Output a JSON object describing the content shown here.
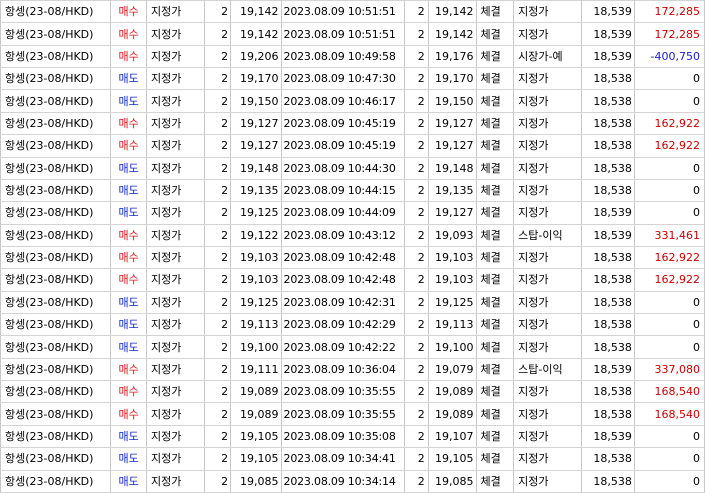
{
  "colors": {
    "buy": "#e0141e",
    "sell": "#1428d2",
    "profit_positive": "#cc0000",
    "profit_negative": "#1a1ad6",
    "profit_zero": "#000000"
  },
  "rows": [
    {
      "product": "항셍(23-08/HKD)",
      "side": "매수",
      "side_type": "buy",
      "order_type": "지정가",
      "qty": "2",
      "order_price": "19,142",
      "datetime": "2023.08.09 10:51:51",
      "fill_qty": "2",
      "fill_price": "19,142",
      "status": "체결",
      "fill_type": "지정가",
      "cur_price": "18,539",
      "profit": "172,285",
      "profit_sign": "pos"
    },
    {
      "product": "항셍(23-08/HKD)",
      "side": "매수",
      "side_type": "buy",
      "order_type": "지정가",
      "qty": "2",
      "order_price": "19,142",
      "datetime": "2023.08.09 10:51:51",
      "fill_qty": "2",
      "fill_price": "19,142",
      "status": "체결",
      "fill_type": "지정가",
      "cur_price": "18,539",
      "profit": "172,285",
      "profit_sign": "pos"
    },
    {
      "product": "항셍(23-08/HKD)",
      "side": "매수",
      "side_type": "buy",
      "order_type": "지정가",
      "qty": "2",
      "order_price": "19,206",
      "datetime": "2023.08.09 10:49:58",
      "fill_qty": "2",
      "fill_price": "19,176",
      "status": "체결",
      "fill_type": "시장가-예",
      "cur_price": "18,539",
      "profit": "-400,750",
      "profit_sign": "neg"
    },
    {
      "product": "항셍(23-08/HKD)",
      "side": "매도",
      "side_type": "sell",
      "order_type": "지정가",
      "qty": "2",
      "order_price": "19,170",
      "datetime": "2023.08.09 10:47:30",
      "fill_qty": "2",
      "fill_price": "19,170",
      "status": "체결",
      "fill_type": "지정가",
      "cur_price": "18,538",
      "profit": "0",
      "profit_sign": "zero"
    },
    {
      "product": "항셍(23-08/HKD)",
      "side": "매도",
      "side_type": "sell",
      "order_type": "지정가",
      "qty": "2",
      "order_price": "19,150",
      "datetime": "2023.08.09 10:46:17",
      "fill_qty": "2",
      "fill_price": "19,150",
      "status": "체결",
      "fill_type": "지정가",
      "cur_price": "18,538",
      "profit": "0",
      "profit_sign": "zero"
    },
    {
      "product": "항셍(23-08/HKD)",
      "side": "매수",
      "side_type": "buy",
      "order_type": "지정가",
      "qty": "2",
      "order_price": "19,127",
      "datetime": "2023.08.09 10:45:19",
      "fill_qty": "2",
      "fill_price": "19,127",
      "status": "체결",
      "fill_type": "지정가",
      "cur_price": "18,538",
      "profit": "162,922",
      "profit_sign": "pos"
    },
    {
      "product": "항셍(23-08/HKD)",
      "side": "매수",
      "side_type": "buy",
      "order_type": "지정가",
      "qty": "2",
      "order_price": "19,127",
      "datetime": "2023.08.09 10:45:19",
      "fill_qty": "2",
      "fill_price": "19,127",
      "status": "체결",
      "fill_type": "지정가",
      "cur_price": "18,538",
      "profit": "162,922",
      "profit_sign": "pos"
    },
    {
      "product": "항셍(23-08/HKD)",
      "side": "매도",
      "side_type": "sell",
      "order_type": "지정가",
      "qty": "2",
      "order_price": "19,148",
      "datetime": "2023.08.09 10:44:30",
      "fill_qty": "2",
      "fill_price": "19,148",
      "status": "체결",
      "fill_type": "지정가",
      "cur_price": "18,538",
      "profit": "0",
      "profit_sign": "zero"
    },
    {
      "product": "항셍(23-08/HKD)",
      "side": "매도",
      "side_type": "sell",
      "order_type": "지정가",
      "qty": "2",
      "order_price": "19,135",
      "datetime": "2023.08.09 10:44:15",
      "fill_qty": "2",
      "fill_price": "19,135",
      "status": "체결",
      "fill_type": "지정가",
      "cur_price": "18,538",
      "profit": "0",
      "profit_sign": "zero"
    },
    {
      "product": "항셍(23-08/HKD)",
      "side": "매도",
      "side_type": "sell",
      "order_type": "지정가",
      "qty": "2",
      "order_price": "19,125",
      "datetime": "2023.08.09 10:44:09",
      "fill_qty": "2",
      "fill_price": "19,127",
      "status": "체결",
      "fill_type": "지정가",
      "cur_price": "18,539",
      "profit": "0",
      "profit_sign": "zero"
    },
    {
      "product": "항셍(23-08/HKD)",
      "side": "매수",
      "side_type": "buy",
      "order_type": "지정가",
      "qty": "2",
      "order_price": "19,122",
      "datetime": "2023.08.09 10:43:12",
      "fill_qty": "2",
      "fill_price": "19,093",
      "status": "체결",
      "fill_type": "스탑-이익",
      "cur_price": "18,539",
      "profit": "331,461",
      "profit_sign": "pos"
    },
    {
      "product": "항셍(23-08/HKD)",
      "side": "매수",
      "side_type": "buy",
      "order_type": "지정가",
      "qty": "2",
      "order_price": "19,103",
      "datetime": "2023.08.09 10:42:48",
      "fill_qty": "2",
      "fill_price": "19,103",
      "status": "체결",
      "fill_type": "지정가",
      "cur_price": "18,538",
      "profit": "162,922",
      "profit_sign": "pos"
    },
    {
      "product": "항셍(23-08/HKD)",
      "side": "매수",
      "side_type": "buy",
      "order_type": "지정가",
      "qty": "2",
      "order_price": "19,103",
      "datetime": "2023.08.09 10:42:48",
      "fill_qty": "2",
      "fill_price": "19,103",
      "status": "체결",
      "fill_type": "지정가",
      "cur_price": "18,538",
      "profit": "162,922",
      "profit_sign": "pos"
    },
    {
      "product": "항셍(23-08/HKD)",
      "side": "매도",
      "side_type": "sell",
      "order_type": "지정가",
      "qty": "2",
      "order_price": "19,125",
      "datetime": "2023.08.09 10:42:31",
      "fill_qty": "2",
      "fill_price": "19,125",
      "status": "체결",
      "fill_type": "지정가",
      "cur_price": "18,538",
      "profit": "0",
      "profit_sign": "zero"
    },
    {
      "product": "항셍(23-08/HKD)",
      "side": "매도",
      "side_type": "sell",
      "order_type": "지정가",
      "qty": "2",
      "order_price": "19,113",
      "datetime": "2023.08.09 10:42:29",
      "fill_qty": "2",
      "fill_price": "19,113",
      "status": "체결",
      "fill_type": "지정가",
      "cur_price": "18,538",
      "profit": "0",
      "profit_sign": "zero"
    },
    {
      "product": "항셍(23-08/HKD)",
      "side": "매도",
      "side_type": "sell",
      "order_type": "지정가",
      "qty": "2",
      "order_price": "19,100",
      "datetime": "2023.08.09 10:42:22",
      "fill_qty": "2",
      "fill_price": "19,100",
      "status": "체결",
      "fill_type": "지정가",
      "cur_price": "18,538",
      "profit": "0",
      "profit_sign": "zero"
    },
    {
      "product": "항셍(23-08/HKD)",
      "side": "매수",
      "side_type": "buy",
      "order_type": "지정가",
      "qty": "2",
      "order_price": "19,111",
      "datetime": "2023.08.09 10:36:04",
      "fill_qty": "2",
      "fill_price": "19,079",
      "status": "체결",
      "fill_type": "스탑-이익",
      "cur_price": "18,539",
      "profit": "337,080",
      "profit_sign": "pos"
    },
    {
      "product": "항셍(23-08/HKD)",
      "side": "매수",
      "side_type": "buy",
      "order_type": "지정가",
      "qty": "2",
      "order_price": "19,089",
      "datetime": "2023.08.09 10:35:55",
      "fill_qty": "2",
      "fill_price": "19,089",
      "status": "체결",
      "fill_type": "지정가",
      "cur_price": "18,538",
      "profit": "168,540",
      "profit_sign": "pos"
    },
    {
      "product": "항셍(23-08/HKD)",
      "side": "매수",
      "side_type": "buy",
      "order_type": "지정가",
      "qty": "2",
      "order_price": "19,089",
      "datetime": "2023.08.09 10:35:55",
      "fill_qty": "2",
      "fill_price": "19,089",
      "status": "체결",
      "fill_type": "지정가",
      "cur_price": "18,538",
      "profit": "168,540",
      "profit_sign": "pos"
    },
    {
      "product": "항셍(23-08/HKD)",
      "side": "매도",
      "side_type": "sell",
      "order_type": "지정가",
      "qty": "2",
      "order_price": "19,105",
      "datetime": "2023.08.09 10:35:08",
      "fill_qty": "2",
      "fill_price": "19,107",
      "status": "체결",
      "fill_type": "지정가",
      "cur_price": "18,539",
      "profit": "0",
      "profit_sign": "zero"
    },
    {
      "product": "항셍(23-08/HKD)",
      "side": "매도",
      "side_type": "sell",
      "order_type": "지정가",
      "qty": "2",
      "order_price": "19,105",
      "datetime": "2023.08.09 10:34:41",
      "fill_qty": "2",
      "fill_price": "19,105",
      "status": "체결",
      "fill_type": "지정가",
      "cur_price": "18,538",
      "profit": "0",
      "profit_sign": "zero"
    },
    {
      "product": "항셍(23-08/HKD)",
      "side": "매도",
      "side_type": "sell",
      "order_type": "지정가",
      "qty": "2",
      "order_price": "19,085",
      "datetime": "2023.08.09 10:34:14",
      "fill_qty": "2",
      "fill_price": "19,085",
      "status": "체결",
      "fill_type": "지정가",
      "cur_price": "18,538",
      "profit": "0",
      "profit_sign": "zero"
    }
  ]
}
